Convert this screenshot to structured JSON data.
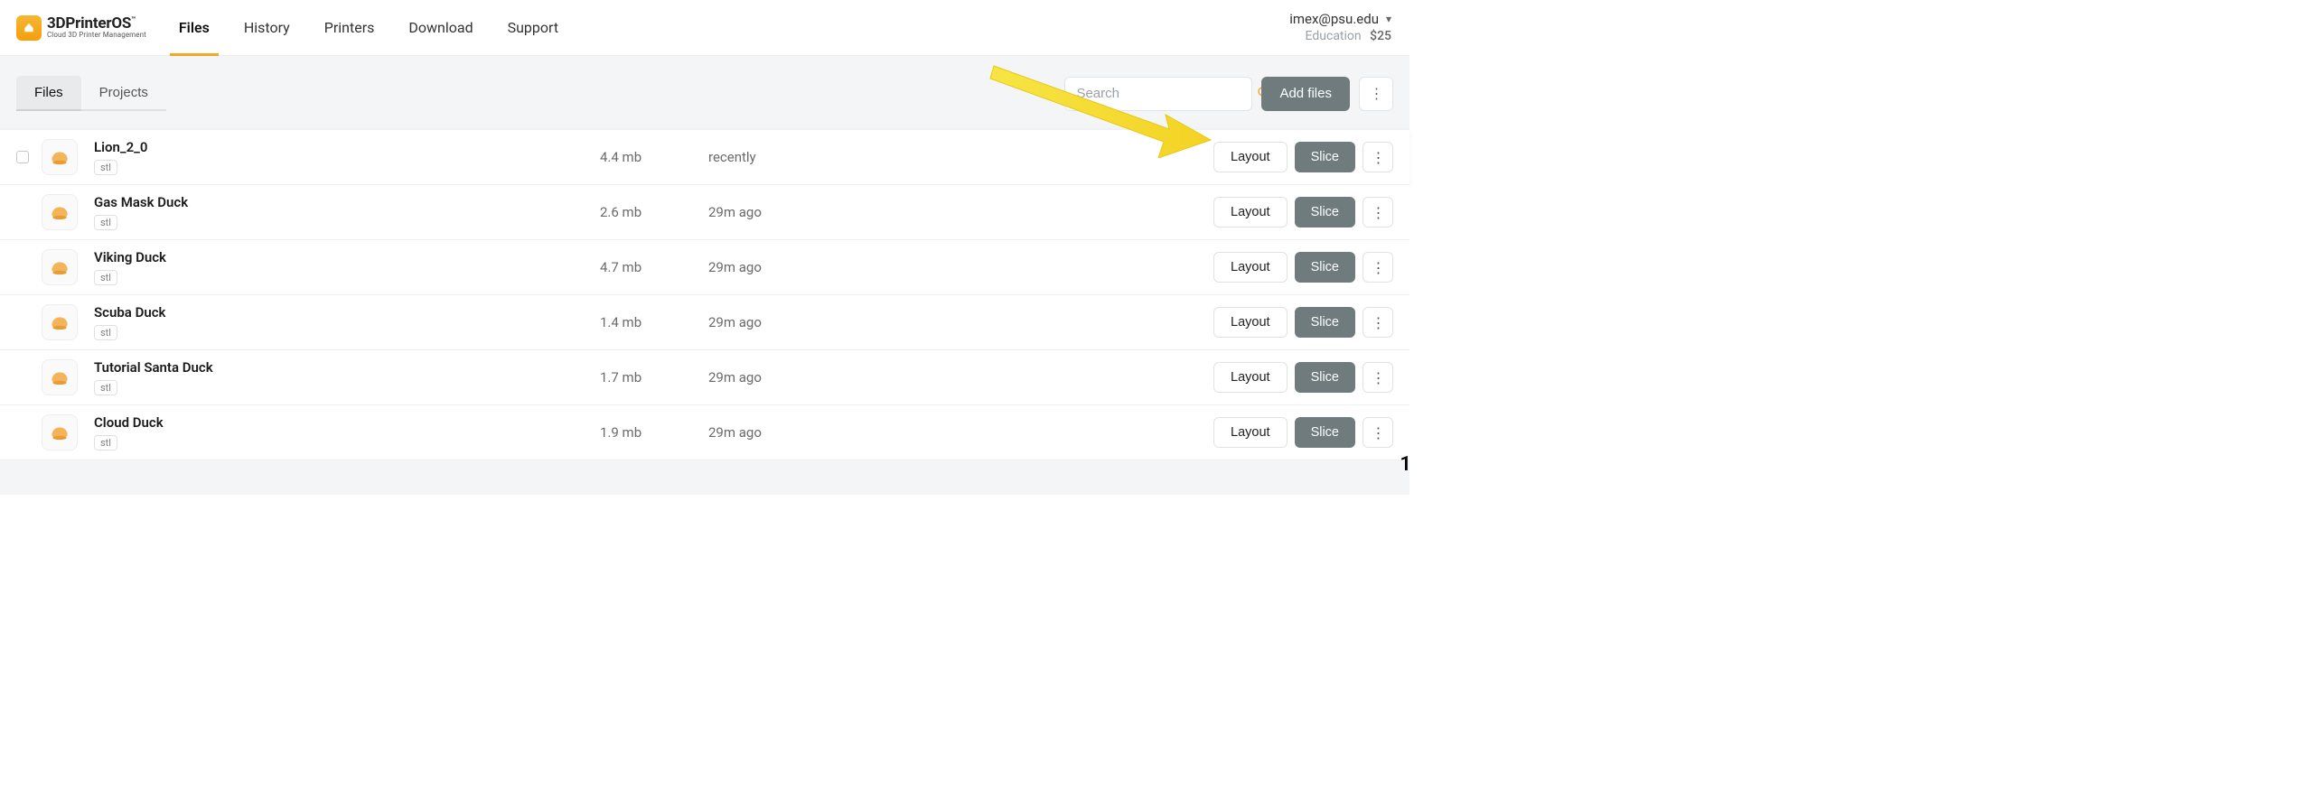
{
  "brand": {
    "name": "3DPrinterOS",
    "tagline": "Cloud 3D Printer Management",
    "tm": "™"
  },
  "nav": {
    "items": [
      "Files",
      "History",
      "Printers",
      "Download",
      "Support"
    ],
    "active_index": 0
  },
  "user": {
    "email": "imex@psu.edu",
    "plan_label": "Education",
    "balance": "$25"
  },
  "tabs": {
    "items": [
      "Files",
      "Projects"
    ],
    "active_index": 0
  },
  "search": {
    "placeholder": "Search",
    "value": ""
  },
  "toolbar": {
    "add_files_label": "Add files"
  },
  "colors": {
    "accent": "#f5a623",
    "btn": "#6f7b7d"
  },
  "row_buttons": {
    "layout": "Layout",
    "slice": "Slice"
  },
  "files": [
    {
      "name": "Lion_2_0",
      "ext": "stl",
      "size": "4.4 mb",
      "time": "recently",
      "icon": "model-icon"
    },
    {
      "name": "Gas Mask Duck",
      "ext": "stl",
      "size": "2.6 mb",
      "time": "29m ago",
      "icon": "model-icon"
    },
    {
      "name": "Viking Duck",
      "ext": "stl",
      "size": "4.7 mb",
      "time": "29m ago",
      "icon": "model-icon"
    },
    {
      "name": "Scuba Duck",
      "ext": "stl",
      "size": "1.4 mb",
      "time": "29m ago",
      "icon": "model-icon"
    },
    {
      "name": "Tutorial Santa Duck",
      "ext": "stl",
      "size": "1.7 mb",
      "time": "29m ago",
      "icon": "model-icon"
    },
    {
      "name": "Cloud Duck",
      "ext": "stl",
      "size": "1.9 mb",
      "time": "29m ago",
      "icon": "model-icon"
    }
  ]
}
